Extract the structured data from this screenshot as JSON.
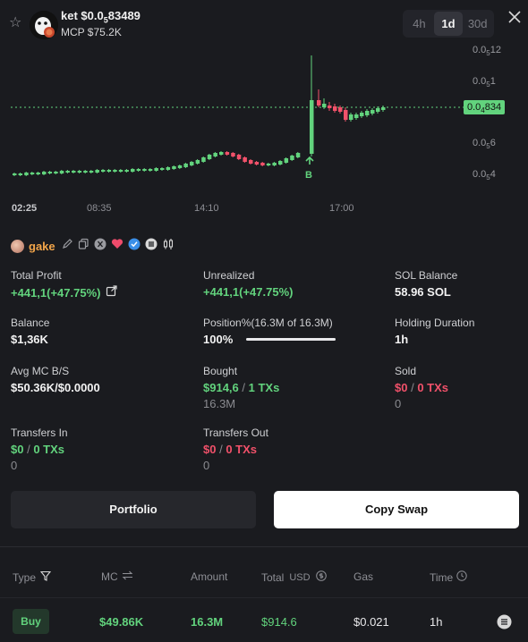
{
  "token": {
    "ticker": "ket",
    "price_prefix": "$0.0",
    "price_subscript": "5",
    "price_digits": "83489",
    "mcp_label": "MCP",
    "mcp_value": "$75.2K"
  },
  "timeframes": [
    {
      "label": "4h",
      "active": false
    },
    {
      "label": "1d",
      "active": true
    },
    {
      "label": "30d",
      "active": false
    }
  ],
  "chart": {
    "price_axis": [
      {
        "prefix": "0.0",
        "sub": "5",
        "rest": "12"
      },
      {
        "prefix": "0.0",
        "sub": "5",
        "rest": "1"
      },
      {
        "prefix": "0.0",
        "sub": "5",
        "rest": "6"
      },
      {
        "prefix": "0.0",
        "sub": "5",
        "rest": "4"
      }
    ],
    "current_price": {
      "prefix": "0.0",
      "sub": "4",
      "rest": "834"
    },
    "time_axis": [
      "02:25",
      "08:35",
      "14:10",
      "17:00"
    ],
    "buy_marker": "B"
  },
  "chart_data": {
    "type": "candlestick",
    "title": "",
    "x_ticks": [
      "02:25",
      "08:35",
      "14:10",
      "17:00"
    ],
    "y_ticks": [
      "0.0₅12",
      "0.0₅1",
      "0.0₅6",
      "0.0₅4"
    ],
    "current_price_label": "0.0₄834",
    "markers": [
      {
        "label": "B",
        "meaning": "buy"
      }
    ],
    "colors": {
      "up": "#62d37d",
      "down": "#f1516a"
    }
  },
  "trader": {
    "name": "gake",
    "icons": [
      "edit-icon",
      "copy-icon",
      "x-icon",
      "heart-icon",
      "verified-icon",
      "menu-icon",
      "candlestick-icon"
    ]
  },
  "stats": {
    "total_profit_label": "Total Profit",
    "total_profit_value": "+441,1(+47.75%)",
    "unrealized_label": "Unrealized",
    "unrealized_value": "+441,1(+47.75%)",
    "sol_balance_label": "SOL Balance",
    "sol_balance_value": "58.96 SOL",
    "balance_label": "Balance",
    "balance_value": "$1,36K",
    "position_label": "Position%(16.3M of 16.3M)",
    "position_value": "100%",
    "position_fraction": 1.0,
    "holding_label": "Holding Duration",
    "holding_value": "1h",
    "avg_mc_label": "Avg MC B/S",
    "avg_mc_value": "$50.36K/$0.0000",
    "bought_label": "Bought",
    "bought_amount": "$914,6",
    "bought_sep": "/",
    "bought_txs": "1 TXs",
    "bought_tokens": "16.3M",
    "sold_label": "Sold",
    "sold_amount": "$0",
    "sold_sep": "/",
    "sold_txs": "0 TXs",
    "sold_tokens": "0",
    "transfers_in_label": "Transfers In",
    "transfers_in_amount": "$0",
    "transfers_in_sep": "/",
    "transfers_in_txs": "0 TXs",
    "transfers_in_tokens": "0",
    "transfers_out_label": "Transfers Out",
    "transfers_out_amount": "$0",
    "transfers_out_sep": "/",
    "transfers_out_txs": "0 TXs",
    "transfers_out_tokens": "0"
  },
  "buttons": {
    "portfolio": "Portfolio",
    "copy_swap": "Copy Swap"
  },
  "table": {
    "headers": {
      "type": "Type",
      "mc": "MC",
      "amount": "Amount",
      "total": "Total",
      "total_unit": "USD",
      "gas": "Gas",
      "time": "Time"
    },
    "rows": [
      {
        "type": "Buy",
        "mc": "$49.86K",
        "amount": "16.3M",
        "total": "$914.6",
        "gas": "$0.021",
        "time": "1h"
      }
    ]
  }
}
